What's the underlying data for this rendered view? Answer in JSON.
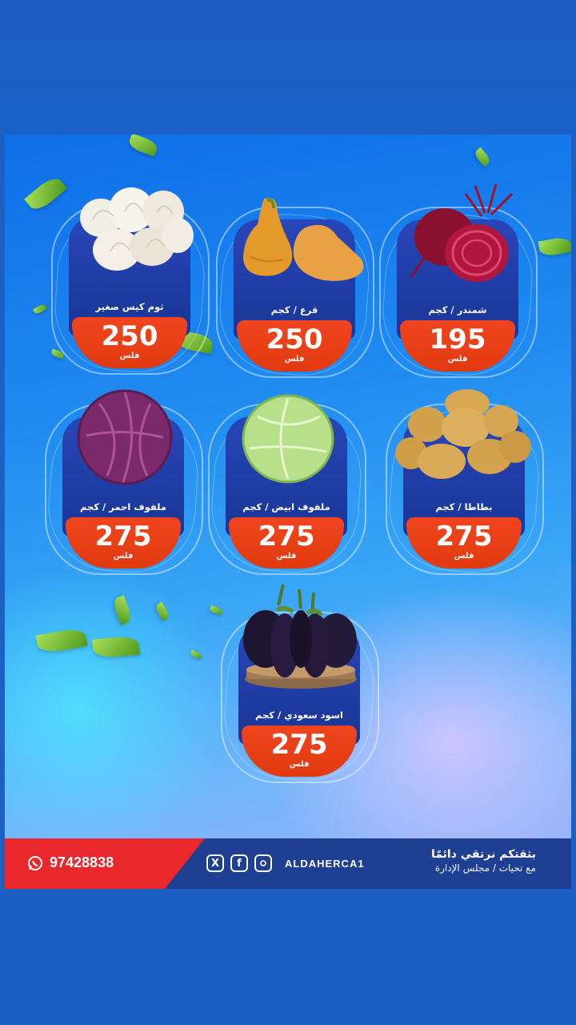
{
  "products": [
    {
      "name": "ثوم كيس صغير",
      "price": "250",
      "unit": "فلس"
    },
    {
      "name": "قرع / كجم",
      "price": "250",
      "unit": "فلس"
    },
    {
      "name": "شمندر / كجم",
      "price": "195",
      "unit": "فلس"
    },
    {
      "name": "ملفوف احمر / كجم",
      "price": "275",
      "unit": "فلس"
    },
    {
      "name": "ملفوف ابيض / كجم",
      "price": "275",
      "unit": "فلس"
    },
    {
      "name": "بطاطا / كجم",
      "price": "275",
      "unit": "فلس"
    },
    {
      "name": "اسود سعودي / كجم",
      "price": "275",
      "unit": "فلس"
    }
  ],
  "footer": {
    "phone": "97428838",
    "handle": "ALDAHERCA1",
    "slogan_line1": "بثقتكم نرتقي دائمًا",
    "slogan_line2": "مع تحيات / مجلس الإدارة"
  },
  "colors": {
    "price_red": "#e8411a",
    "footer_blue": "#1f3f93",
    "footer_red": "#e8282b"
  }
}
